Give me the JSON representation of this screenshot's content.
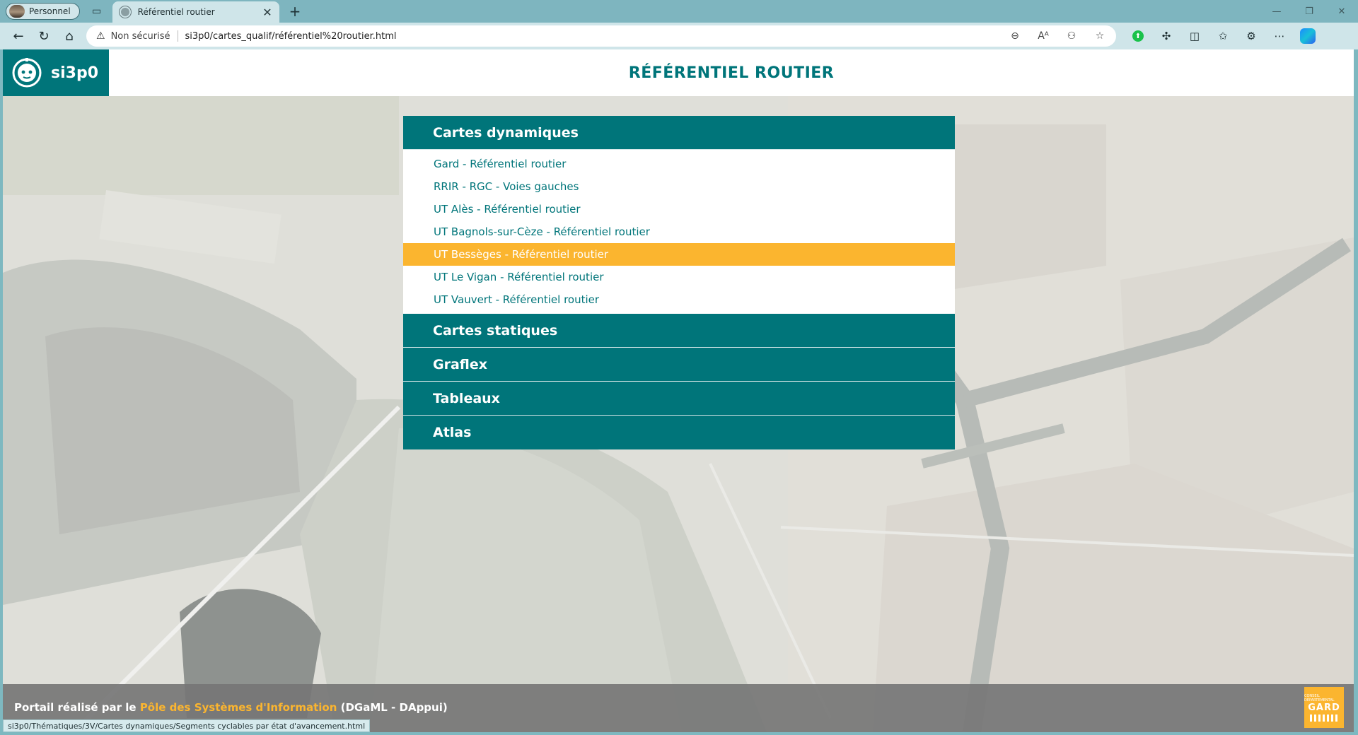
{
  "browser": {
    "profile_label": "Personnel",
    "tab_title": "Référentiel routier",
    "new_tab": "+",
    "close_tab": "✕",
    "security_label": "Non sécurisé",
    "url": "si3p0/cartes_qualif/référentiel%20routier.html",
    "window_minimize": "—",
    "window_restore": "❐",
    "window_close": "✕"
  },
  "header": {
    "logo_text": "si3p0",
    "title": "RÉFÉRENTIEL ROUTIER"
  },
  "menu": {
    "sections": [
      {
        "label": "Cartes dynamiques",
        "expanded": true,
        "items": [
          {
            "label": "Gard - Référentiel routier"
          },
          {
            "label": "RRIR - RGC - Voies gauches"
          },
          {
            "label": "UT Alès - Référentiel routier"
          },
          {
            "label": "UT Bagnols-sur-Cèze - Référentiel routier"
          },
          {
            "label": "UT Bessèges - Référentiel routier",
            "active": true
          },
          {
            "label": "UT Le Vigan - Référentiel routier"
          },
          {
            "label": "UT Vauvert - Référentiel routier"
          }
        ]
      },
      {
        "label": "Cartes statiques"
      },
      {
        "label": "Graflex"
      },
      {
        "label": "Tableaux"
      },
      {
        "label": "Atlas"
      }
    ]
  },
  "footer": {
    "prefix": "Portail réalisé par le ",
    "link": "Pôle des Systèmes d'Information",
    "suffix": " (DGaML - DAppui)",
    "gard_logo_text": "GARD",
    "gard_logo_small": "CONSEIL DÉPARTEMENTAL"
  },
  "status_bar": "si3p0/Thématiques/3V/Cartes dynamiques/Segments cyclables par état d'avancement.html",
  "colors": {
    "teal": "#00757a",
    "accent": "#fbb52f",
    "tab_strip": "#7eb5bf"
  }
}
